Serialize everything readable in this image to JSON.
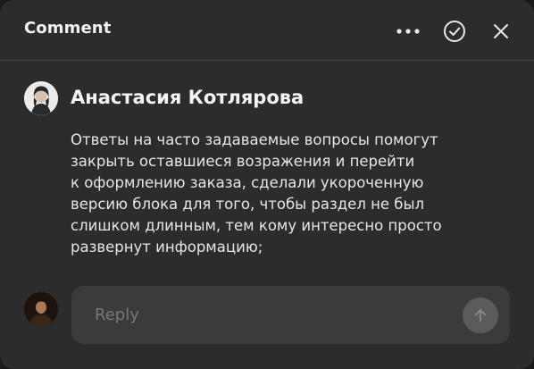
{
  "header": {
    "title": "Comment",
    "more_icon": "more-horizontal-icon",
    "resolve_icon": "check-circle-icon",
    "close_icon": "close-icon"
  },
  "comment": {
    "author": "Анастасия Котлярова",
    "avatar_icon": "user-avatar",
    "text": "Ответы на часто задаваемые вопросы помогут\nзакрыть оставшиеся возражения и перейти\nк оформлению заказа, сделали укороченную\nверсию блока для того, чтобы раздел не был\nслишком длинным, тем кому интересно просто\nразвернут информацию;"
  },
  "reply": {
    "placeholder": "Reply",
    "value": "",
    "send_icon": "arrow-up-icon",
    "avatar_icon": "user-avatar"
  },
  "colors": {
    "panel_bg": "#2c2c2c",
    "input_bg": "#3b3b3b",
    "send_button_bg": "#5b5b5b",
    "text_primary": "#f4f4f4"
  }
}
